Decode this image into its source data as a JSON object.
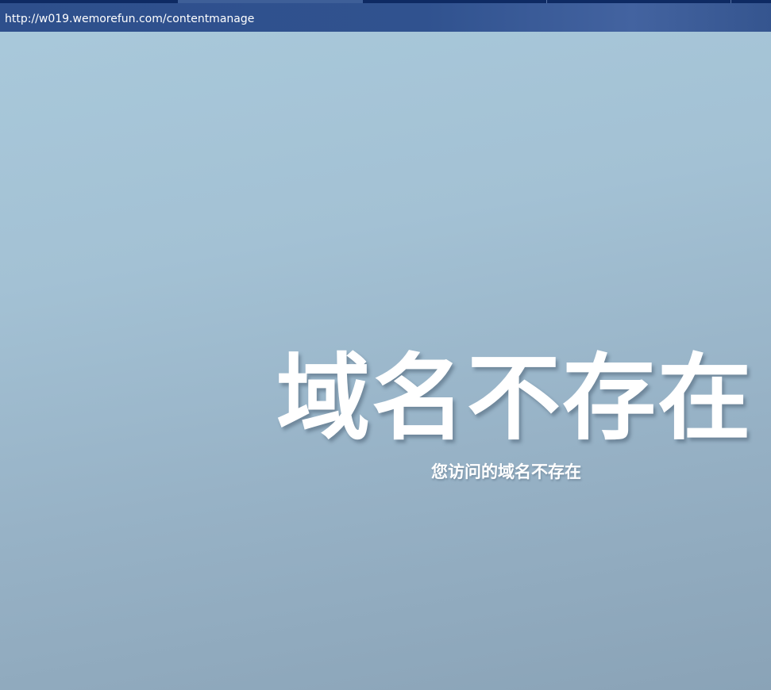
{
  "browser": {
    "url": "http://w019.wemorefun.com/contentmanage"
  },
  "error_page": {
    "headline": "域名不存在",
    "message": "您访问的域名不存在"
  }
}
